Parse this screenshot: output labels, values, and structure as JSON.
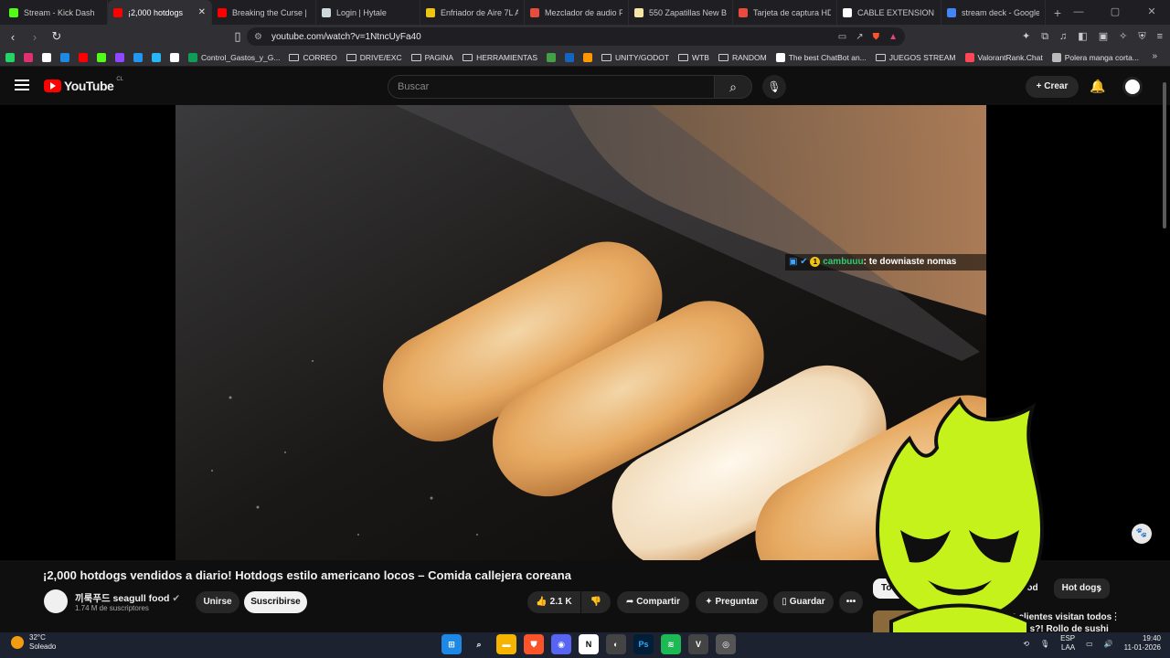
{
  "browser": {
    "tabs": [
      {
        "title": "Stream - Kick Dash",
        "color": "#53fc18",
        "active": false
      },
      {
        "title": "¡2,000 hotdogs",
        "color": "#ff0000",
        "active": true
      },
      {
        "title": "Breaking the Curse | N",
        "color": "#ff0000",
        "active": false
      },
      {
        "title": "Login | Hytale",
        "color": "#cfd8dc",
        "active": false
      },
      {
        "title": "Enfriador de Aire 7L AC",
        "color": "#f1c40f",
        "active": false
      },
      {
        "title": "Mezclador de audio FI",
        "color": "#e74c3c",
        "active": false
      },
      {
        "title": "550 Zapatillas New Bal",
        "color": "#f5e6a8",
        "active": false
      },
      {
        "title": "Tarjeta de captura HDI",
        "color": "#e74c3c",
        "active": false
      },
      {
        "title": "CABLE EXTENSION MA",
        "color": "#ffffff",
        "active": false
      },
      {
        "title": "stream deck - Google",
        "color": "#4285f4",
        "active": false
      }
    ],
    "tab_close": "✕",
    "new_tab": "+",
    "url": "youtube.com/watch?v=1NtncUyFa40",
    "bookmarks": [
      {
        "label": "",
        "type": "icon",
        "color": "#25d366"
      },
      {
        "label": "",
        "type": "icon",
        "color": "#e1306c"
      },
      {
        "label": "",
        "type": "icon",
        "color": "#ffffff"
      },
      {
        "label": "",
        "type": "icon",
        "color": "#1e88e5"
      },
      {
        "label": "",
        "type": "icon",
        "color": "#ff0000"
      },
      {
        "label": "",
        "type": "icon",
        "color": "#53fc18"
      },
      {
        "label": "",
        "type": "icon",
        "color": "#9146ff"
      },
      {
        "label": "",
        "type": "icon",
        "color": "#2196f3"
      },
      {
        "label": "",
        "type": "icon",
        "color": "#29b6f6"
      },
      {
        "label": "",
        "type": "icon",
        "color": "#ffffff"
      },
      {
        "label": "Control_Gastos_y_G...",
        "type": "icon",
        "color": "#0f9d58"
      },
      {
        "label": "CORREO",
        "type": "folder"
      },
      {
        "label": "DRIVE/EXC",
        "type": "folder"
      },
      {
        "label": "PAGINA",
        "type": "folder"
      },
      {
        "label": "HERRAMIENTAS",
        "type": "folder"
      },
      {
        "label": "",
        "type": "icon",
        "color": "#43a047"
      },
      {
        "label": "",
        "type": "icon",
        "color": "#1565c0"
      },
      {
        "label": "",
        "type": "icon",
        "color": "#ff9800"
      },
      {
        "label": "UNITY/GODOT",
        "type": "folder"
      },
      {
        "label": "WTB",
        "type": "folder"
      },
      {
        "label": "RANDOM",
        "type": "folder"
      },
      {
        "label": "The best ChatBot an...",
        "type": "icon",
        "color": "#ffffff"
      },
      {
        "label": "JUEGOS STREAM",
        "type": "folder"
      },
      {
        "label": "ValorantRank.Chat",
        "type": "icon",
        "color": "#ff4655"
      },
      {
        "label": "Polera manga corta...",
        "type": "icon",
        "color": "#bbbbbb"
      }
    ]
  },
  "youtube": {
    "logo_text": "YouTube",
    "country": "CL",
    "search_placeholder": "Buscar",
    "create_label": "Crear",
    "chat_overlay": {
      "nick": "cambuuu",
      "message": ": te downiaste nomas",
      "badge": "1"
    },
    "video_title": "¡2,000 hotdogs vendidos a diario! Hotdogs estilo americano locos – Comida callejera coreana",
    "channel_name": "끼룩푸드 seagull food",
    "subscribers": "1.74 M de suscriptores",
    "join_label": "Unirse",
    "subscribe_label": "Suscribirse",
    "likes": "2.1 K",
    "share_label": "Compartir",
    "ask_label": "Preguntar",
    "save_label": "Guardar",
    "more_label": "•••",
    "filters": [
      "Todos",
      "ood",
      "Hot dogs"
    ],
    "next_chip": "›",
    "recommendation_title": "600 clientes visitan todos los días?! Rollo de sushi"
  },
  "taskbar": {
    "temperature": "32°C",
    "weather": "Soleado",
    "lang_top": "ESP",
    "lang_bottom": "LAA",
    "time": "19:40",
    "date": "11-01-2026"
  }
}
